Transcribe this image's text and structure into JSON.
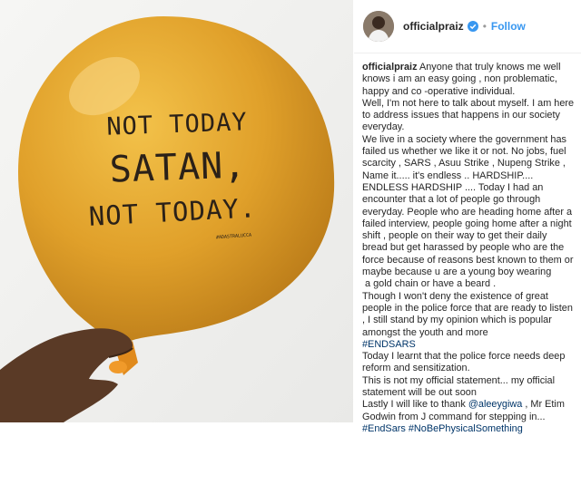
{
  "post": {
    "photo": {
      "alt_icon": "balloon-photo",
      "balloon_color": "#e3a52b",
      "balloon_text": [
        "NOT TODAY",
        "SATAN,",
        "NOT TODAY."
      ],
      "balloon_small_text": "#ADASTRALUCCA"
    },
    "header": {
      "username": "officialpraiz",
      "verified_icon": "verified-badge-icon",
      "separator": "•",
      "follow_label": "Follow"
    },
    "caption": {
      "author": "officialpraiz",
      "lines": [
        " Anyone that truly knows me well knows i am an easy going , non problematic, happy and co -operative individual.",
        "Well, I'm not here to talk about myself. I am here to address issues that happens in our society everyday.",
        "We live in a society where the government has failed us whether we like it or not. No jobs, fuel scarcity , SARS , Asuu Strike , Nupeng Strike , Name it..... it's endless .. HARDSHIP.... ENDLESS HARDSHIP .... Today I had an encounter that a lot of people go through everyday. People who are heading home after a failed interview, people going home after a night shift , people on their way to get their daily bread but get harassed by people who are the force because of reasons best known to them or maybe because u are a young boy wearing",
        "a gold chain or have a beard .",
        "Though I won't deny the existence of great people in the police force that are ready to listen , I still stand by my opinion which is popular amongst the youth and more",
        "#ENDSARS",
        "Today I learnt that the police force needs deep reform and sensitization.",
        "This is not my official statement... my official statement will be out soon",
        "Lastly I will like to thank ",
        "@aleeygiwa",
        " , Mr Etim Godwin from J command for stepping in... ",
        "#EndSars",
        "#NoBePhysicalSomething"
      ]
    }
  }
}
